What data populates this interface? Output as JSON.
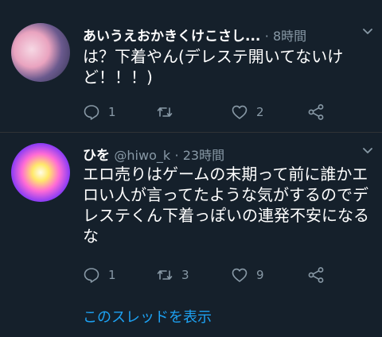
{
  "tweets": [
    {
      "name": "あいうえおかきくけこさし...",
      "handle": "",
      "time": "8時間",
      "text": "は？下着やん(デレステ開いてないけど！！！)",
      "replies": "1",
      "retweets": "",
      "likes": "2"
    },
    {
      "name": "ひを",
      "handle": "@hiwo_k",
      "time": "23時間",
      "text": "エロ売りはゲームの末期って前に誰かエロい人が言ってたような気がするのでデレステくん下着っぽいの連発不安になるな",
      "replies": "1",
      "retweets": "3",
      "likes": "9"
    }
  ],
  "thread_link": "このスレッドを表示",
  "colors": {
    "background": "#15202b",
    "meta": "#8899a6",
    "link": "#1da1f2",
    "divider": "#2f3336"
  },
  "icons": [
    "reply-icon",
    "retweet-icon",
    "like-icon",
    "share-icon",
    "chevron-down-icon",
    "avatar"
  ]
}
